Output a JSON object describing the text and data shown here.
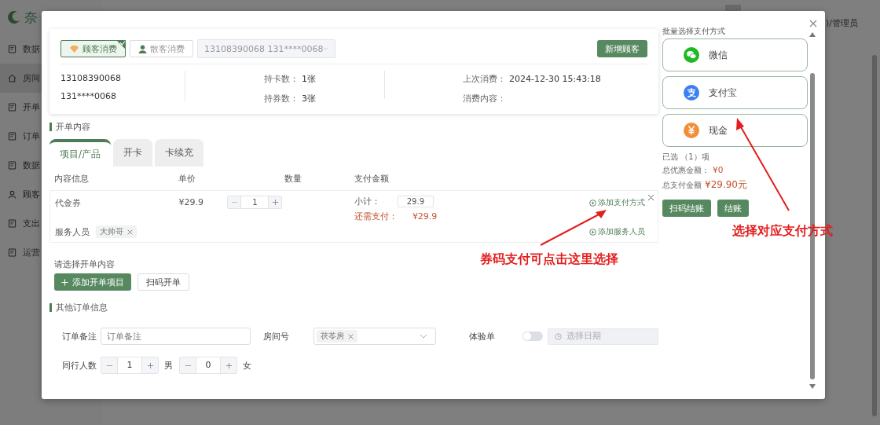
{
  "background_app": {
    "logo_text": "奈",
    "sidebar": [
      {
        "label": "数据",
        "kind": "monitor",
        "selected": false
      },
      {
        "label": "房间",
        "kind": "home",
        "selected": true
      },
      {
        "label": "开单",
        "kind": "doc",
        "selected": false
      },
      {
        "label": "订单",
        "kind": "order",
        "selected": false
      },
      {
        "label": "数据",
        "kind": "chart",
        "selected": false
      },
      {
        "label": "顾客",
        "kind": "user",
        "selected": false
      },
      {
        "label": "支出",
        "kind": "wallet",
        "selected": false
      },
      {
        "label": "运营",
        "kind": "settings",
        "selected": false
      }
    ],
    "user_role": ")/管理员"
  },
  "modal": {
    "customer": {
      "modes": [
        {
          "label": "顾客消费",
          "kind": "member",
          "selected": true
        },
        {
          "label": "散客消费",
          "kind": "guest",
          "selected": false
        }
      ],
      "customer_select": {
        "value": "13108390068 131****0068",
        "disabled": true
      },
      "new_button": "新增顾客",
      "phone": "13108390068",
      "masked_phone": "131****0068",
      "stats": [
        {
          "label": "持卡数：",
          "value": "1张"
        },
        {
          "label": "持券数：",
          "value": "3张"
        }
      ],
      "history": [
        {
          "label": "上次消费：",
          "value": "2024-12-30 15:43:18"
        },
        {
          "label": "消费内容："
        }
      ]
    },
    "section_title": "开单内容",
    "tabs": [
      {
        "label": "项目/产品",
        "selected": true
      },
      {
        "label": "开卡",
        "selected": false
      },
      {
        "label": "卡续充",
        "selected": false
      }
    ],
    "columns": [
      "内容信息",
      "单价",
      "数量",
      "支付金额"
    ],
    "items": [
      {
        "name": "代金券",
        "price": "¥29.9",
        "quantity": "1",
        "subtotal_label": "小计：",
        "subtotal": "29.9",
        "due_label": "还需支付：",
        "due": "¥29.9",
        "add_payment": "添加支付方式",
        "staff_label": "服务人员",
        "staff": [
          "大帅哥"
        ],
        "add_staff": "添加服务人员"
      }
    ],
    "choose_hint": "请选择开单内容",
    "add_item_button": "添加开单项目",
    "scan_button": "扫码开单",
    "other_title": "其他订单信息",
    "note": {
      "label": "订单备注",
      "placeholder": "订单备注"
    },
    "room": {
      "label": "房间号",
      "tags": [
        "茯苓房"
      ]
    },
    "trial": {
      "label": "体验单",
      "on": false
    },
    "date": {
      "placeholder": "选择日期",
      "disabled": true
    },
    "companions": {
      "label": "同行人数",
      "groups": [
        {
          "value": "1",
          "unit": "男"
        },
        {
          "value": "0",
          "unit": "女"
        }
      ]
    },
    "payment": {
      "title": "批量选择支付方式",
      "methods": [
        {
          "label": "微信",
          "kind": "wechat"
        },
        {
          "label": "支付宝",
          "kind": "alipay"
        },
        {
          "label": "现金",
          "kind": "cash"
        }
      ],
      "selected_count": "已选 （1）项",
      "discount_label": "总优惠金额：",
      "discount": "¥0",
      "total_label": "总支付金额",
      "total": "¥29.90元",
      "buttons": [
        "扫码结账",
        "结账"
      ]
    }
  },
  "annotations": [
    {
      "text": "券码支付可点击这里选择"
    },
    {
      "text": "选择对应支付方式"
    }
  ]
}
